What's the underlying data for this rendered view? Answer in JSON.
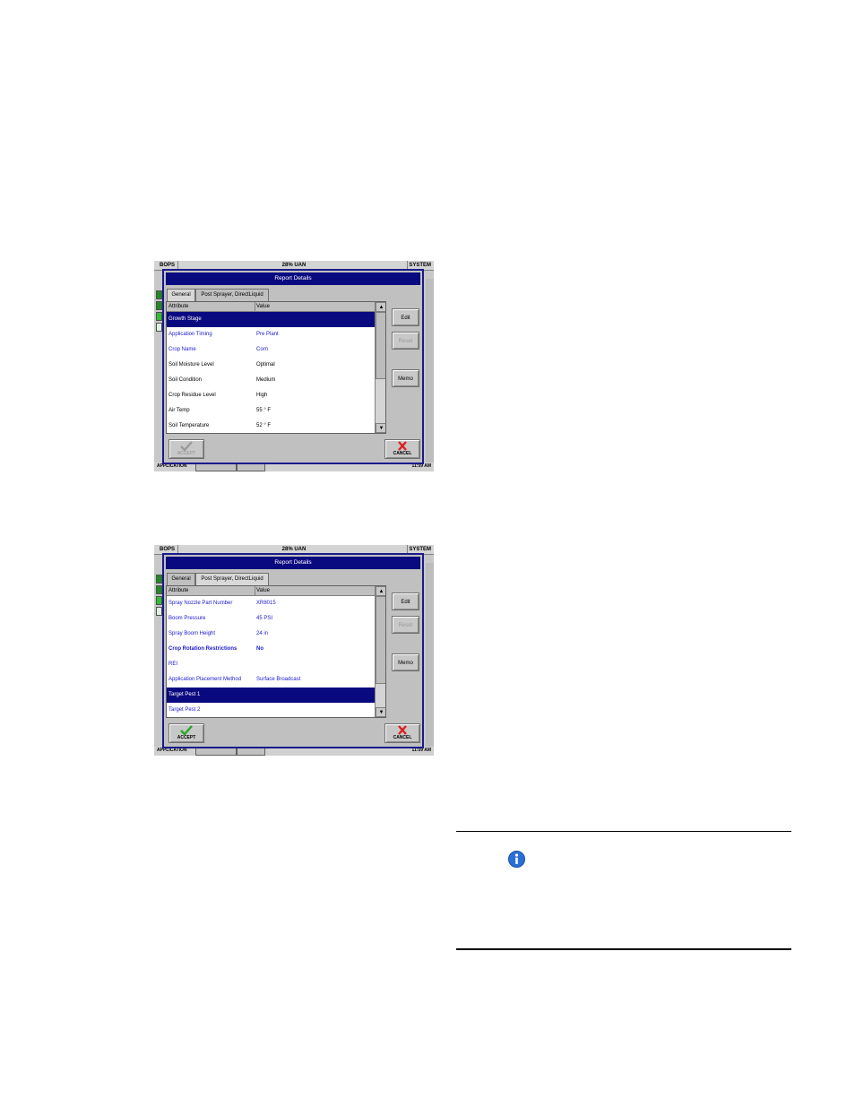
{
  "background_bar": {
    "left": "BOPS",
    "center": "28% UAN",
    "right": "SYSTEM"
  },
  "screens": [
    {
      "dialog_title": "Report Details",
      "tabs": [
        "General",
        "Post Sprayer, DirectLiquid"
      ],
      "active_tab": 0,
      "columns": {
        "attribute": "Attribute",
        "value": "Value"
      },
      "rows": [
        {
          "attribute": "Growth Stage",
          "value": ""
        },
        {
          "attribute": "Application Timing",
          "value": "Pre Plant"
        },
        {
          "attribute": "Crop Name",
          "value": "Corn"
        },
        {
          "attribute": "Soil Moisture Level",
          "value": "Optimal"
        },
        {
          "attribute": "Soil Condition",
          "value": "Medium"
        },
        {
          "attribute": "Crop Residue Level",
          "value": "High"
        },
        {
          "attribute": "Air Temp",
          "value": "55 ° F"
        },
        {
          "attribute": "Soil Temperature",
          "value": "52 ° F"
        }
      ],
      "buttons": {
        "edit": "Edit",
        "reset": "Reset",
        "memo": "Memo",
        "accept": "ACCEPT",
        "cancel": "CANCEL"
      },
      "status": {
        "left": "APPLICATION",
        "right": "11:59 AM"
      }
    },
    {
      "dialog_title": "Report Details",
      "tabs": [
        "General",
        "Post Sprayer, DirectLiquid"
      ],
      "active_tab": 1,
      "columns": {
        "attribute": "Attribute",
        "value": "Value"
      },
      "rows": [
        {
          "attribute": "Spray Nozzle Part Number",
          "value": "XR8015"
        },
        {
          "attribute": "Boom Pressure",
          "value": "45 PSI"
        },
        {
          "attribute": "Spray Boom Height",
          "value": "24 in"
        },
        {
          "attribute": "Crop Rotation Restrictions",
          "value": "No"
        },
        {
          "attribute": "REI",
          "value": ""
        },
        {
          "attribute": "Application Placement Method",
          "value": "Surface Broadcast"
        },
        {
          "attribute": "Target Pest 1",
          "value": ""
        },
        {
          "attribute": "Target Pest 2",
          "value": ""
        }
      ],
      "buttons": {
        "edit": "Edit",
        "reset": "Reset",
        "memo": "Memo",
        "accept": "ACCEPT",
        "cancel": "CANCEL"
      },
      "status": {
        "left": "APPLICATION",
        "right": "11:59 AM"
      }
    }
  ],
  "colors": {
    "title_bar": "#0a0a80",
    "selected_row": "#0a0a80",
    "blue_text": "#1a1ad0",
    "accept_check": "#22aa22",
    "cancel_x": "#dd2020",
    "info_icon": "#2a6fd6"
  },
  "icons": {
    "accept": "check-icon",
    "cancel": "x-icon",
    "note": "info-icon"
  }
}
